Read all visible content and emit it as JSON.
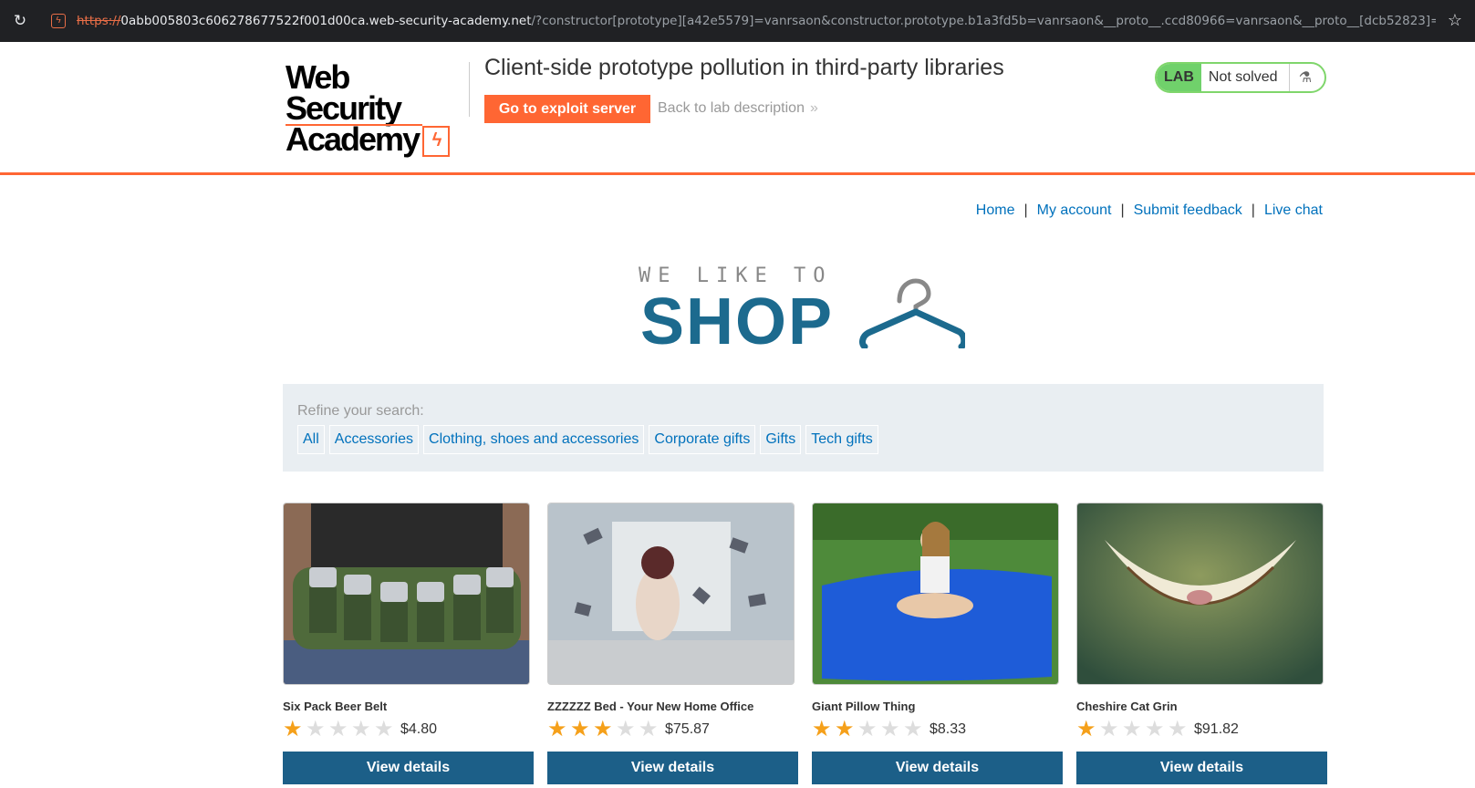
{
  "browser": {
    "url_scheme": "https://",
    "url_host": "0abb005803c606278677522f001d00ca.web-security-academy.net",
    "url_rest": "/?constructor[prototype][a42e5579]=vanrsaon&constructor.prototype.b1a3fd5b=vanrsaon&__proto__.ccd80966=vanrsaon&__proto__[dcb52823]=vanrsaon&cons…",
    "reload_glyph": "↻",
    "bookmark_glyph": "☆"
  },
  "academy": {
    "logo_line1": "Web Security",
    "logo_line2": "Academy",
    "logo_bolt": "ϟ",
    "lab_title": "Client-side prototype pollution in third-party libraries",
    "exploit_button": "Go to exploit server",
    "back_link": "Back to lab description",
    "back_chevron": "»",
    "status_tag": "LAB",
    "status_text": "Not solved",
    "flask_glyph": "⚗"
  },
  "nav": {
    "home": "Home",
    "account": "My account",
    "feedback": "Submit feedback",
    "chat": "Live chat",
    "separator": "|"
  },
  "banner": {
    "small": "WE LIKE TO",
    "big": "SHOP"
  },
  "filter": {
    "label": "Refine your search:",
    "categories": [
      "All",
      "Accessories",
      "Clothing, shoes and accessories",
      "Corporate gifts",
      "Gifts",
      "Tech gifts"
    ]
  },
  "products": [
    {
      "name": "Six Pack Beer Belt",
      "rating": 1,
      "price": "$4.80",
      "button": "View details"
    },
    {
      "name": "ZZZZZZ Bed - Your New Home Office",
      "rating": 3,
      "price": "$75.87",
      "button": "View details"
    },
    {
      "name": "Giant Pillow Thing",
      "rating": 2,
      "price": "$8.33",
      "button": "View details"
    },
    {
      "name": "Cheshire Cat Grin",
      "rating": 1,
      "price": "$91.82",
      "button": "View details"
    }
  ],
  "colors": {
    "accent": "#ff6633",
    "link": "#0071bc",
    "button": "#1c5f88",
    "lab_green": "#70d16b"
  }
}
